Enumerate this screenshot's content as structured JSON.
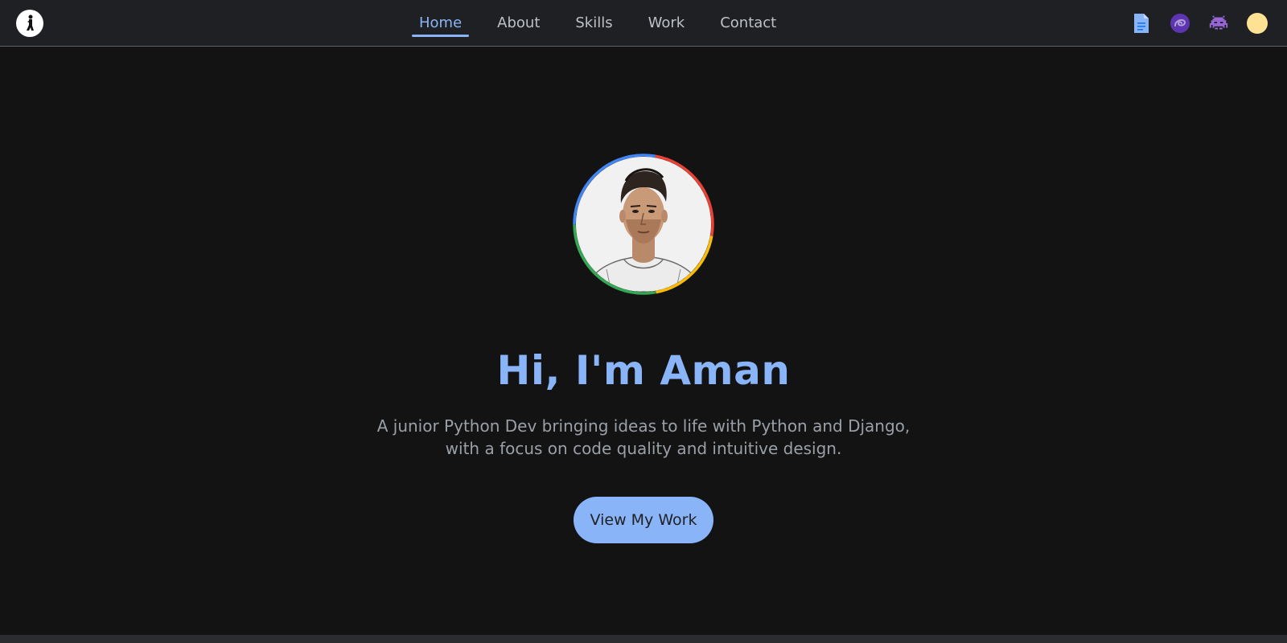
{
  "nav": {
    "links": [
      {
        "label": "Home",
        "active": true
      },
      {
        "label": "About",
        "active": false
      },
      {
        "label": "Skills",
        "active": false
      },
      {
        "label": "Work",
        "active": false
      },
      {
        "label": "Contact",
        "active": false
      }
    ],
    "icons": [
      "document-icon",
      "swirl-icon",
      "alien-monster-icon",
      "theme-toggle-icon"
    ]
  },
  "hero": {
    "title": "Hi, I'm Aman",
    "subtitle": "A junior Python Dev bringing ideas to life with Python and Django, with a focus on code quality and intuitive design.",
    "cta_label": "View My Work"
  },
  "colors": {
    "accent": "#8ab4f8",
    "background": "#131314",
    "navbar": "#1f2023",
    "ring_red": "#ea4335",
    "ring_blue": "#4285f4",
    "ring_yellow": "#fbbc05",
    "ring_green": "#34a853"
  }
}
